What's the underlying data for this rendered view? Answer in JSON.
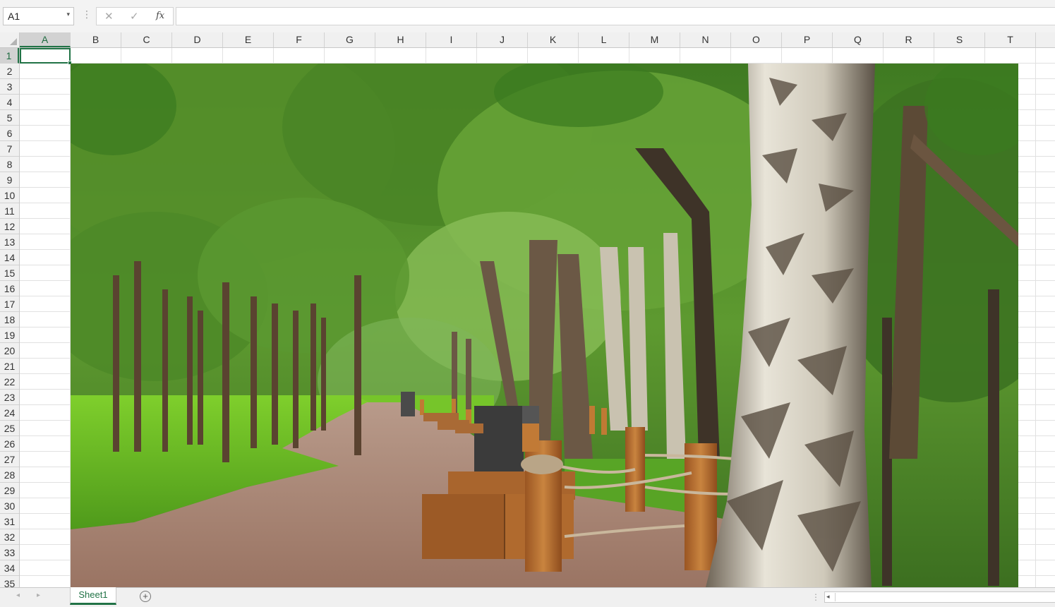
{
  "formula_bar": {
    "name_box": "A1",
    "name_box_dropdown": "▾",
    "dots": "⋮",
    "cancel_symbol": "✕",
    "enter_symbol": "✓",
    "fx_label": "fx",
    "formula": ""
  },
  "columns": [
    "A",
    "B",
    "C",
    "D",
    "E",
    "F",
    "G",
    "H",
    "I",
    "J",
    "K",
    "L",
    "M",
    "N",
    "O",
    "P",
    "Q",
    "R",
    "S",
    "T"
  ],
  "rows": [
    "1",
    "2",
    "3",
    "4",
    "5",
    "6",
    "7",
    "8",
    "9",
    "10",
    "11",
    "12",
    "13",
    "14",
    "15",
    "16",
    "17",
    "18",
    "19",
    "20",
    "21",
    "22",
    "23",
    "24",
    "25",
    "26",
    "27",
    "28",
    "29",
    "30",
    "31",
    "32",
    "33",
    "34",
    "35"
  ],
  "active_cell": "A1",
  "picture": {
    "icon": "park-photo",
    "colors": {
      "foliage": "#4f8a2a",
      "grass": "#6cc023",
      "path": "#a98575",
      "bench": "#b06a2e",
      "birch": "#d8d4c8"
    }
  },
  "sheet_tabs": [
    {
      "label": "Sheet1",
      "active": true
    }
  ],
  "bottom_bar": {
    "prev_arrow": "◂",
    "next_arrow": "▸",
    "add_sheet_symbol": "+",
    "dots": "⋮",
    "scroll_left": "◂"
  }
}
